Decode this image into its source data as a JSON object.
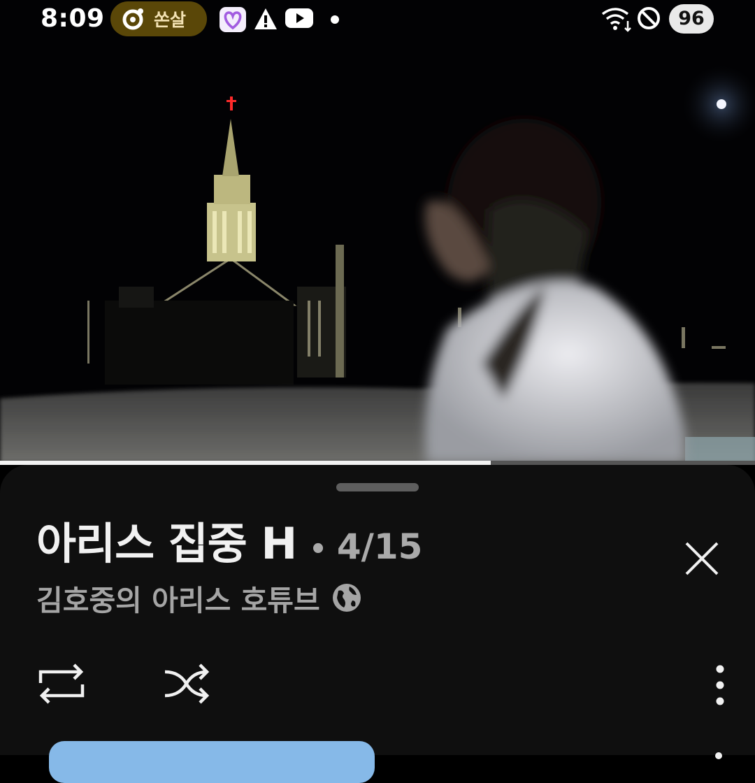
{
  "status_bar": {
    "time": "8:09",
    "pill_label": "쏜살",
    "battery": "96",
    "icons": [
      "pill-app-icon",
      "app-heart-icon",
      "alert-icon",
      "youtube-icon",
      "notification-dot",
      "wifi-icon",
      "do-not-disturb-icon"
    ]
  },
  "video": {
    "progress_fraction": 0.65
  },
  "playlist_panel": {
    "title": "아리스 집중 H",
    "separator": "•",
    "position": "4/15",
    "channel": "김호중의 아리스 호튜브",
    "visibility_icon": "globe-icon",
    "controls": [
      "loop-icon",
      "shuffle-icon",
      "more-vert-icon",
      "close-icon"
    ]
  },
  "colors": {
    "sheet_background": "#0f0f0f",
    "title": "#f1f1f1",
    "secondary_text": "#aaaaaa",
    "pill_background": "#5a4708",
    "next_card": "#86b9e8"
  }
}
